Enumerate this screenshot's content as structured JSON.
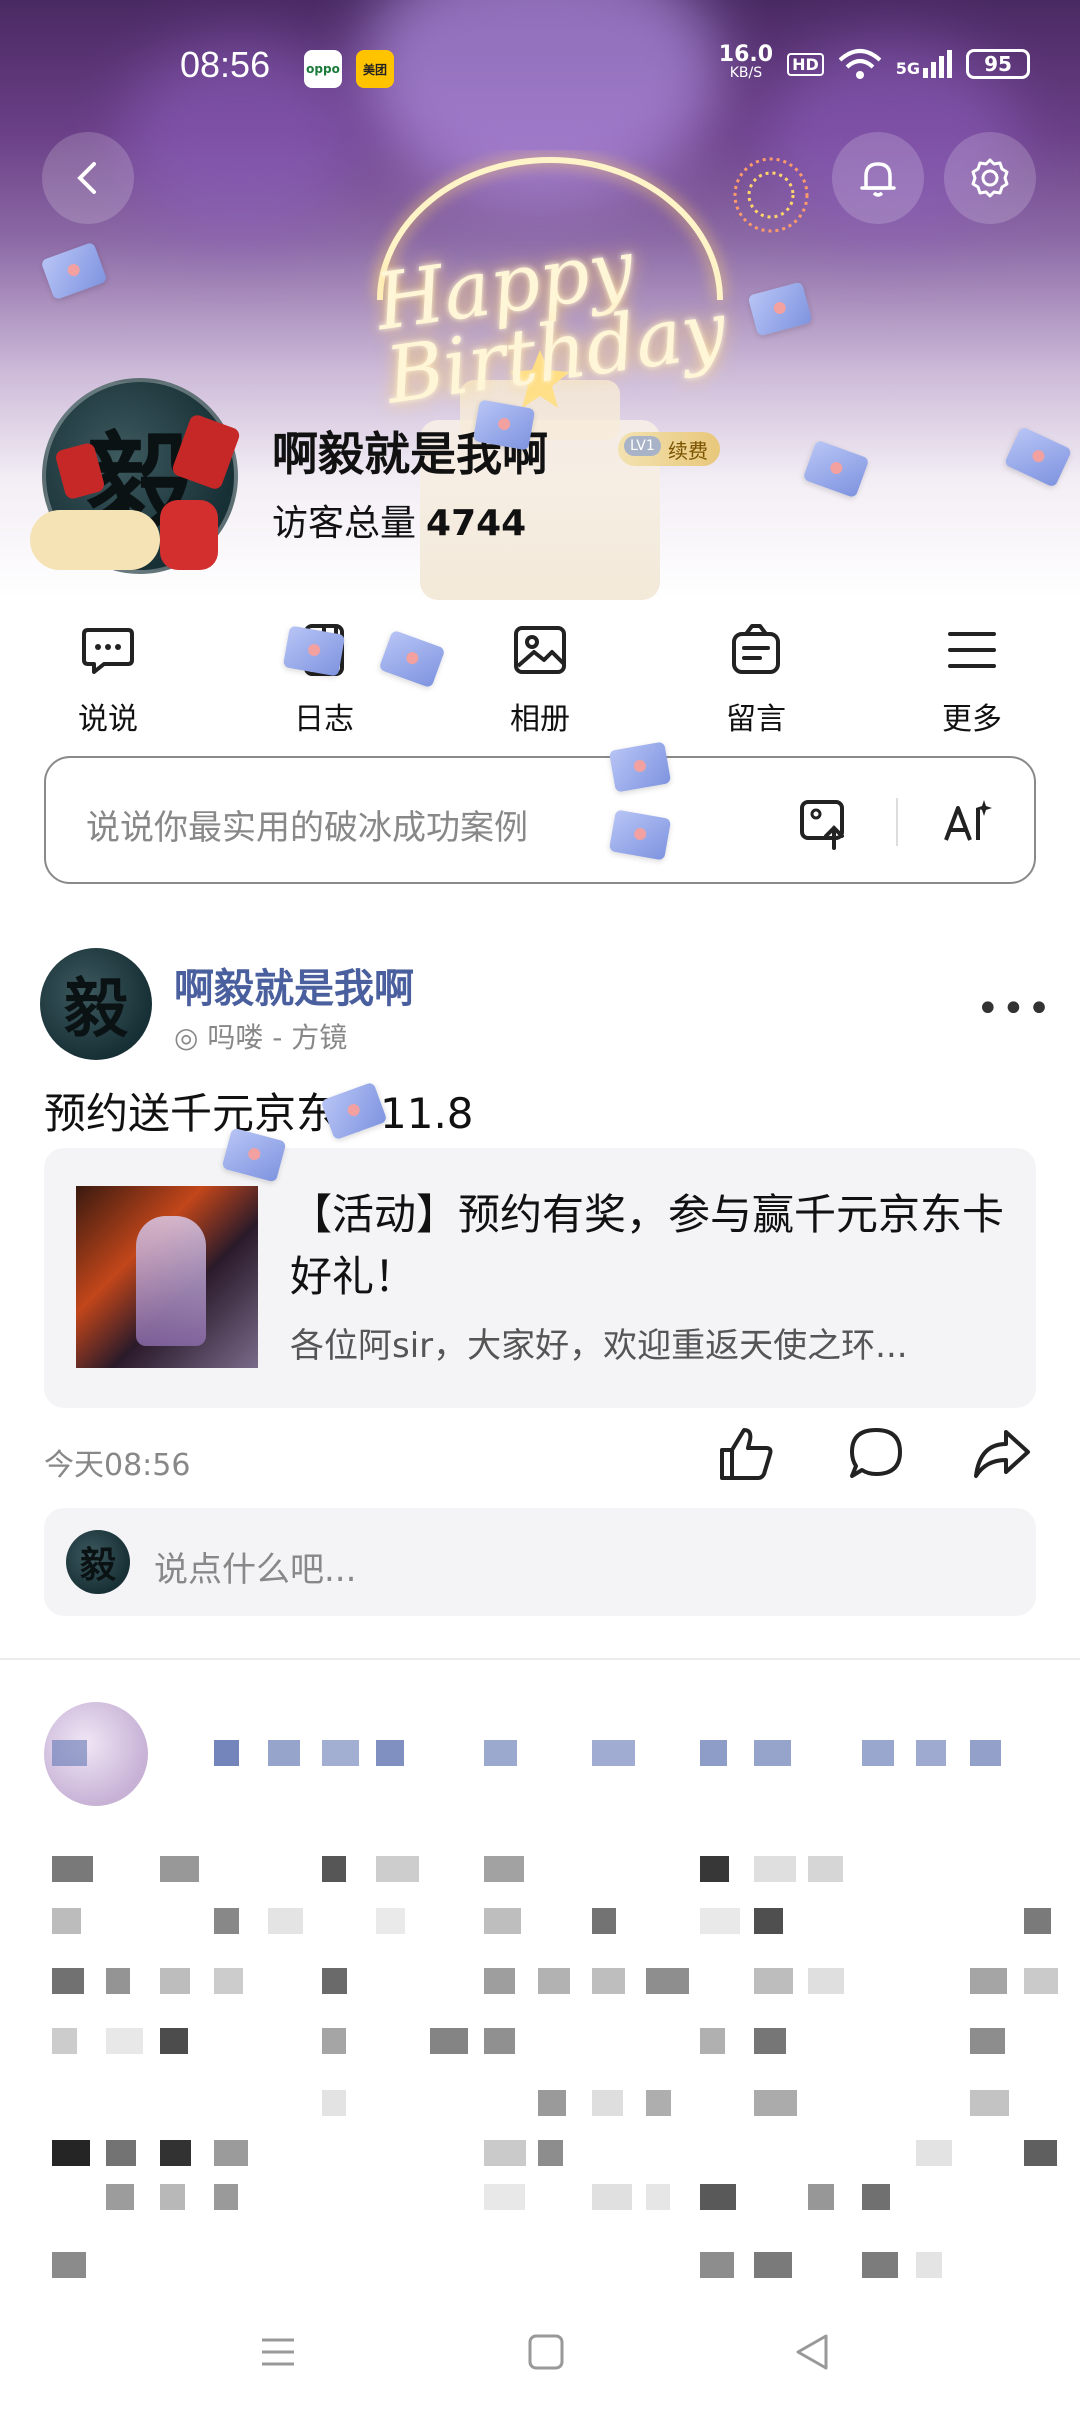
{
  "status_bar": {
    "time": "08:56",
    "network_speed": "16.0",
    "network_unit": "KB/S",
    "hd": "HD",
    "signal": "5G",
    "battery": "95",
    "app_badge_1": "oppo",
    "app_badge_2": "美团"
  },
  "header": {
    "greeting_art": "Happy Birthday",
    "profile_name": "啊毅就是我啊",
    "level_badge": "LV1",
    "renew_label": "续费",
    "visits_label": "访客总量",
    "visits_count": "4744",
    "avatar_glyph": "毅"
  },
  "shortcuts": [
    {
      "label": "说说",
      "icon": "chat-bubble-icon"
    },
    {
      "label": "日志",
      "icon": "journal-icon"
    },
    {
      "label": "相册",
      "icon": "photo-album-icon"
    },
    {
      "label": "留言",
      "icon": "message-board-icon"
    },
    {
      "label": "更多",
      "icon": "menu-icon"
    }
  ],
  "composer": {
    "placeholder": "说说你最实用的破冰成功案例"
  },
  "post": {
    "author": "啊毅就是我啊",
    "meta": "吗喽 - 方镜",
    "text": "预约送千元京东卡11.8",
    "link_title": "【活动】预约有奖，参与赢千元京东卡好礼！",
    "link_desc": "各位阿sir，大家好，欢迎重返天使之环...",
    "time": "今天08:56",
    "comment_placeholder": "说点什么吧..."
  },
  "colors": {
    "author_link": "#4a5f9e",
    "hero_top": "#4a2a63",
    "envelope": "#8fa3e8"
  }
}
